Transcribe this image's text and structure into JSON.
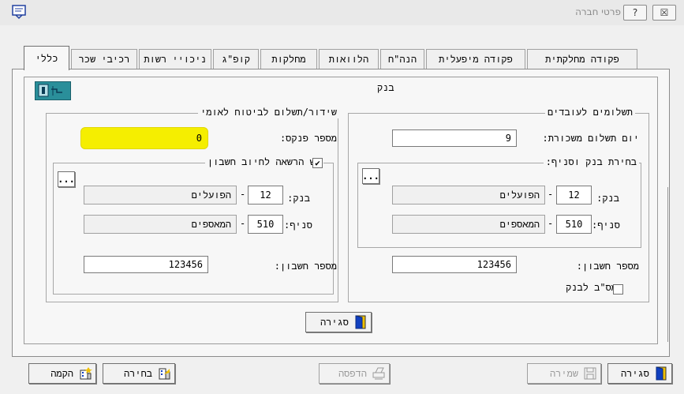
{
  "window": {
    "title": "פרטי חברה",
    "help_label": "?",
    "close_label": "☒"
  },
  "tabs": [
    {
      "label": "כללי",
      "active": true
    },
    {
      "label": "רכיבי שכר"
    },
    {
      "label": "ניכויי רשות"
    },
    {
      "label": "קופ\"ג"
    },
    {
      "label": "מחלקות"
    },
    {
      "label": "הלוואות"
    },
    {
      "label": "הנה\"ח"
    },
    {
      "label": "פקודה מיפעלית"
    },
    {
      "label": "פקודה מחלקתית"
    }
  ],
  "panel": {
    "title": "בנק",
    "close_button": "סגירה"
  },
  "employee_payments": {
    "legend": "תשלומים לעובדים",
    "pay_day_label": "יום תשלום משכורת:",
    "pay_day_value": "9",
    "bank_branch_legend": "בחירת בנק וסניף:",
    "bank_label": "בנק:",
    "bank_code": "12",
    "bank_name": "הפועלים",
    "branch_label": "סניף:",
    "branch_code": "510",
    "branch_name": "המאספים",
    "account_label": "מספר חשבון:",
    "account_value": "123456",
    "msv_label": "מס\"ב לבנק",
    "msv_checked": false,
    "ellipsis": "..."
  },
  "national_insurance": {
    "legend": "שידור/תשלום לביטוח לאומי",
    "file_no_label": "מספר פנקס:",
    "file_no_value": "0",
    "debit_auth_legend": "יש הרשאה לחיוב חשבון",
    "debit_auth_checked": true,
    "bank_label": "בנק:",
    "bank_code": "12",
    "bank_name": "הפועלים",
    "branch_label": "סניף:",
    "branch_code": "510",
    "branch_name": "המאספים",
    "account_label": "מספר חשבון:",
    "account_value": "123456",
    "ellipsis": "..."
  },
  "footer": {
    "close_button": "סגירה",
    "save_button": "שמירה",
    "print_button": "הדפסה",
    "select_button": "בחירה",
    "create_button": "הקמה"
  },
  "colors": {
    "highlight": "#f5ee00",
    "door_blue": "#1040c0",
    "door_yellow": "#f0c000"
  }
}
